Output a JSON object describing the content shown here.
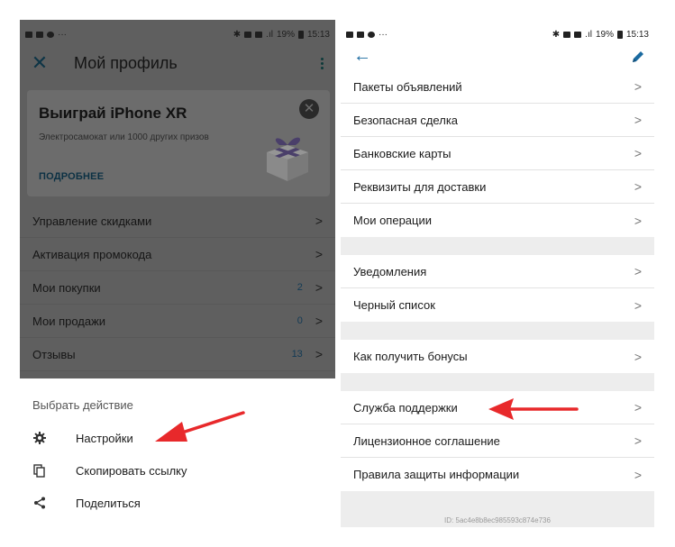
{
  "left": {
    "status_bar": {
      "time": "15:13",
      "battery": "19%"
    },
    "appbar": {
      "title": "Мой профиль"
    },
    "promo": {
      "title": "Выиграй iPhone XR",
      "text": "Электросамокат или 1000 других призов",
      "link": "ПОДРОБНЕЕ"
    },
    "menu": [
      {
        "label": "Управление скидками",
        "count": ""
      },
      {
        "label": "Активация промокода",
        "count": ""
      },
      {
        "label": "Мои покупки",
        "count": "2"
      },
      {
        "label": "Мои продажи",
        "count": "0"
      },
      {
        "label": "Отзывы",
        "count": "13"
      }
    ],
    "sheet": {
      "title": "Выбрать действие",
      "items": [
        {
          "label": "Настройки",
          "icon": "gear-icon"
        },
        {
          "label": "Скопировать ссылку",
          "icon": "copy-icon"
        },
        {
          "label": "Поделиться",
          "icon": "share-icon"
        }
      ]
    }
  },
  "right": {
    "status_bar": {
      "time": "15:13",
      "battery": "19%"
    },
    "groups": [
      [
        "Пакеты объявлений",
        "Безопасная сделка",
        "Банковские карты",
        "Реквизиты для доставки",
        "Мои операции"
      ],
      [
        "Уведомления",
        "Черный список"
      ],
      [
        "Как получить бонусы"
      ],
      [
        "Служба поддержки",
        "Лицензионное соглашение",
        "Правила защиты информации"
      ]
    ],
    "id_text": "ID: 5ac4e8b8ec985593c874e736"
  },
  "colors": {
    "accent": "#1a6aa0",
    "annotation_arrow": "#e8292b",
    "dim_overlay": "#5f5f5f"
  }
}
